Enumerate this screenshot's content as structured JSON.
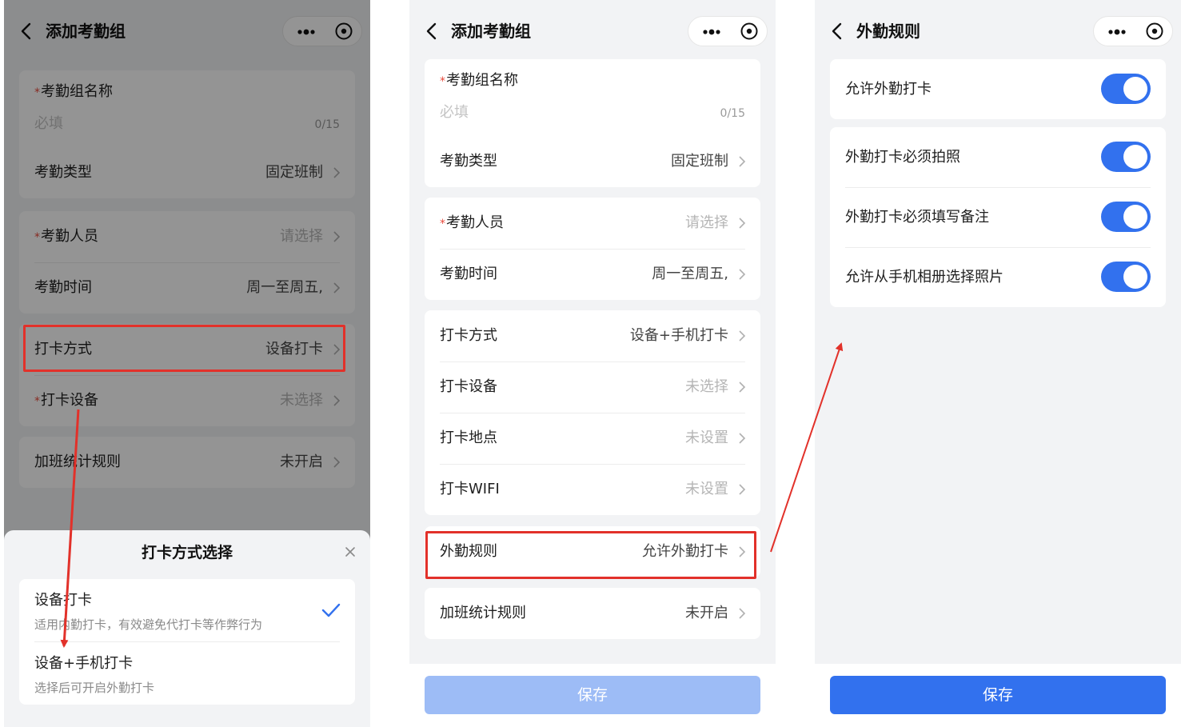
{
  "colors": {
    "accent": "#3271ee",
    "accent_disabled": "#9dbcf6",
    "required": "#e84a3c",
    "annotation": "#e2312a",
    "background": "#f2f3f5"
  },
  "panel1": {
    "nav": {
      "title": "添加考勤组"
    },
    "group_name": {
      "required_mark": "*",
      "label": "考勤组名称",
      "placeholder": "必填",
      "counter": "0/15"
    },
    "type": {
      "label": "考勤类型",
      "value": "固定班制"
    },
    "members": {
      "required_mark": "*",
      "label": "考勤人员",
      "value": "请选择"
    },
    "time": {
      "label": "考勤时间",
      "value": "周一至周五,"
    },
    "punch_method": {
      "label": "打卡方式",
      "value": "设备打卡"
    },
    "punch_device": {
      "required_mark": "*",
      "label": "打卡设备",
      "value": "未选择"
    },
    "overtime": {
      "label": "加班统计规则",
      "value": "未开启"
    },
    "sheet": {
      "title": "打卡方式选择",
      "options": [
        {
          "title": "设备打卡",
          "desc": "适用内勤打卡，有效避免代打卡等作弊行为",
          "selected": true
        },
        {
          "title": "设备+手机打卡",
          "desc": "选择后可开启外勤打卡",
          "selected": false
        }
      ]
    }
  },
  "panel2": {
    "nav": {
      "title": "添加考勤组"
    },
    "group_name": {
      "required_mark": "*",
      "label": "考勤组名称",
      "placeholder": "必填",
      "counter": "0/15"
    },
    "type": {
      "label": "考勤类型",
      "value": "固定班制"
    },
    "members": {
      "required_mark": "*",
      "label": "考勤人员",
      "value": "请选择"
    },
    "time": {
      "label": "考勤时间",
      "value": "周一至周五,"
    },
    "punch_method": {
      "label": "打卡方式",
      "value": "设备+手机打卡"
    },
    "punch_device": {
      "label": "打卡设备",
      "value": "未选择"
    },
    "punch_location": {
      "label": "打卡地点",
      "value": "未设置"
    },
    "punch_wifi": {
      "label": "打卡WIFI",
      "value": "未设置"
    },
    "field_rules": {
      "label": "外勤规则",
      "value": "允许外勤打卡"
    },
    "overtime": {
      "label": "加班统计规则",
      "value": "未开启"
    },
    "save_label": "保存"
  },
  "panel3": {
    "nav": {
      "title": "外勤规则"
    },
    "toggles": [
      {
        "label": "允许外勤打卡",
        "on": true
      },
      {
        "label": "外勤打卡必须拍照",
        "on": true
      },
      {
        "label": "外勤打卡必须填写备注",
        "on": true
      },
      {
        "label": "允许从手机相册选择照片",
        "on": true
      }
    ],
    "save_label": "保存"
  }
}
